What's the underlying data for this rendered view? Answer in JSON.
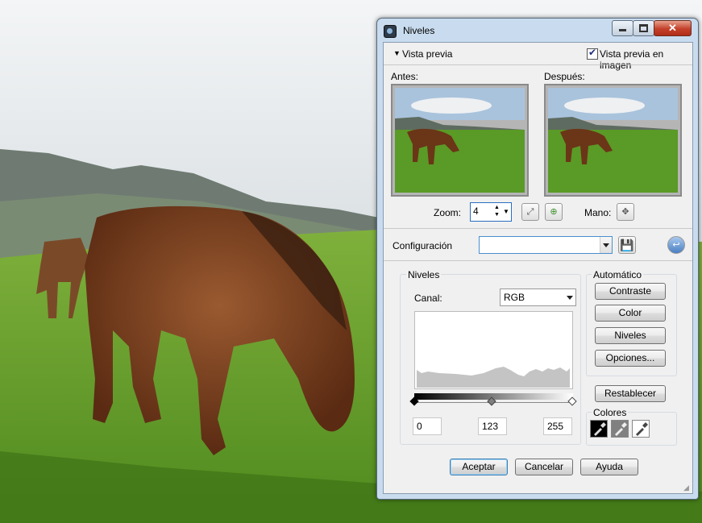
{
  "dialog": {
    "title": "Niveles",
    "window_buttons": {
      "minimize": "minimize-icon",
      "maximize": "maximize-icon",
      "close": "✕"
    },
    "preview_toggle": "Vista previa",
    "preview_in_image": {
      "label": "Vista previa en imagen",
      "checked": true
    },
    "before_label": "Antes:",
    "after_label": "Después:",
    "zoom": {
      "label": "Zoom:",
      "value": "4"
    },
    "hand_label": "Mano:",
    "config_label": "Configuración",
    "config_value": "",
    "levels_group": {
      "title": "Niveles",
      "channel_label": "Canal:",
      "channel_value": "RGB",
      "histogram_icon": "histogram",
      "inputs": {
        "black": "0",
        "mid": "123",
        "white": "255"
      }
    },
    "auto_group": {
      "title": "Automático",
      "buttons": [
        "Contraste",
        "Color",
        "Niveles",
        "Opciones..."
      ]
    },
    "reset_button": "Restablecer",
    "colors_group": {
      "title": "Colores",
      "eyedroppers": [
        "black-eyedropper-icon",
        "gray-eyedropper-icon",
        "white-eyedropper-icon"
      ]
    },
    "footer": {
      "ok": "Aceptar",
      "cancel": "Cancelar",
      "help": "Ayuda"
    }
  },
  "colors": {
    "sky": "#dfe5ea",
    "grass": "#5f9a2a",
    "horse": "#7a3f20",
    "title_accent": "#c4402a"
  }
}
